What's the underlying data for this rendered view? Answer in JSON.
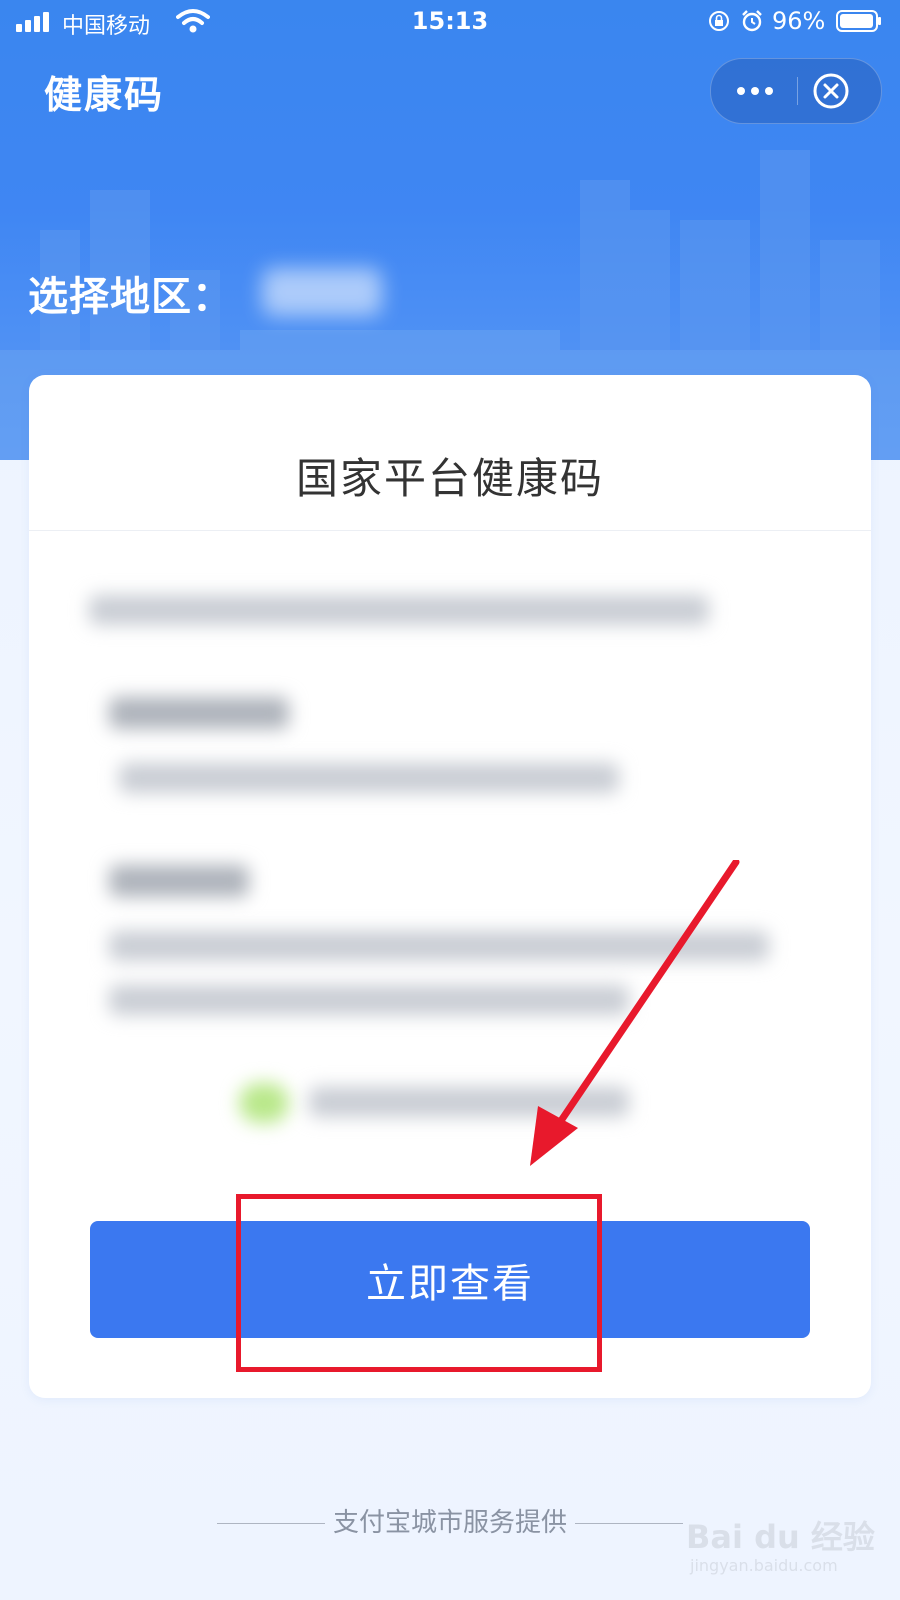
{
  "status_bar": {
    "carrier": "中国移动",
    "time": "15:13",
    "battery": "96%"
  },
  "nav": {
    "title": "健康码"
  },
  "region": {
    "label": "选择地区："
  },
  "card": {
    "title": "国家平台健康码",
    "button_label": "立即查看"
  },
  "footer": {
    "text": "支付宝城市服务提供"
  },
  "watermark": {
    "brand": "Bai du 经验",
    "url": "jingyan.baidu.com"
  },
  "colors": {
    "primary": "#3b78f0",
    "header": "#3f86f3",
    "highlight": "#e8192c"
  },
  "icons": [
    "signal-icon",
    "wifi-icon",
    "rotation-lock-icon",
    "alarm-icon",
    "battery-icon",
    "more-icon",
    "close-icon",
    "arrow-annotation"
  ]
}
